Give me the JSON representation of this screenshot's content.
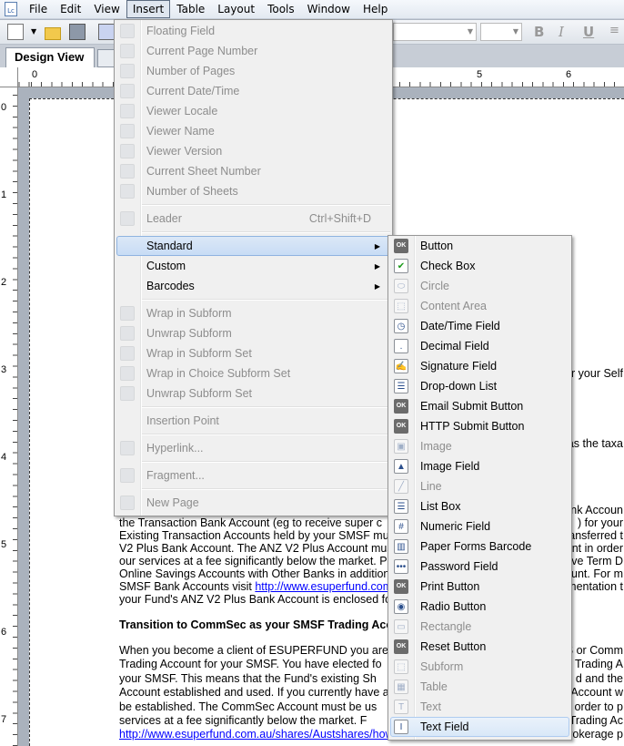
{
  "menubar": {
    "items": [
      "File",
      "Edit",
      "View",
      "Insert",
      "Table",
      "Layout",
      "Tools",
      "Window",
      "Help"
    ],
    "open": "Insert"
  },
  "tabs": {
    "design": "Design View"
  },
  "ruler": {
    "h": [
      "0",
      "5",
      "6"
    ],
    "v": [
      "0",
      "1",
      "2",
      "3",
      "4",
      "5",
      "6",
      "7"
    ]
  },
  "insert_menu": [
    {
      "label": "Floating Field",
      "icon": "floating-field-icon",
      "disabled": true
    },
    {
      "label": "Current Page Number",
      "icon": "page-number-icon",
      "disabled": true
    },
    {
      "label": "Number of Pages",
      "icon": "number-pages-icon",
      "disabled": true
    },
    {
      "label": "Current Date/Time",
      "icon": "date-time-icon",
      "disabled": true
    },
    {
      "label": "Viewer Locale",
      "icon": "viewer-locale-icon",
      "disabled": true
    },
    {
      "label": "Viewer Name",
      "icon": "viewer-name-icon",
      "disabled": true
    },
    {
      "label": "Viewer Version",
      "icon": "viewer-version-icon",
      "disabled": true
    },
    {
      "label": "Current Sheet Number",
      "icon": "sheet-number-icon",
      "disabled": true
    },
    {
      "label": "Number of Sheets",
      "icon": "number-sheets-icon",
      "disabled": true
    },
    {
      "sep": true
    },
    {
      "label": "Leader",
      "icon": "leader-icon",
      "disabled": true,
      "shortcut": "Ctrl+Shift+D"
    },
    {
      "sep": true
    },
    {
      "label": "Standard",
      "submenu": true,
      "highlighted": true
    },
    {
      "label": "Custom",
      "submenu": true
    },
    {
      "label": "Barcodes",
      "submenu": true
    },
    {
      "sep": true
    },
    {
      "label": "Wrap in Subform",
      "icon": "wrap-subform-icon",
      "disabled": true
    },
    {
      "label": "Unwrap Subform",
      "icon": "unwrap-subform-icon",
      "disabled": true
    },
    {
      "label": "Wrap in Subform Set",
      "icon": "wrap-subform-set-icon",
      "disabled": true
    },
    {
      "label": "Wrap in Choice Subform Set",
      "icon": "wrap-choice-subform-icon",
      "disabled": true
    },
    {
      "label": "Unwrap Subform Set",
      "icon": "unwrap-subform-set-icon",
      "disabled": true
    },
    {
      "sep": true
    },
    {
      "label": "Insertion Point",
      "disabled": true
    },
    {
      "sep": true
    },
    {
      "label": "Hyperlink...",
      "icon": "hyperlink-icon",
      "disabled": true
    },
    {
      "sep": true
    },
    {
      "label": "Fragment...",
      "icon": "fragment-icon",
      "disabled": true
    },
    {
      "sep": true
    },
    {
      "label": "New Page",
      "icon": "new-page-icon",
      "disabled": true
    }
  ],
  "standard_menu": [
    {
      "label": "Button",
      "icon": "ok-button-icon",
      "glyph": "OK"
    },
    {
      "label": "Check Box",
      "icon": "checkbox-icon",
      "glyph": "✔"
    },
    {
      "label": "Circle",
      "icon": "circle-icon",
      "glyph": "⬭",
      "disabled": true
    },
    {
      "label": "Content Area",
      "icon": "content-area-icon",
      "glyph": "⬚",
      "disabled": true
    },
    {
      "label": "Date/Time Field",
      "icon": "date-time-field-icon",
      "glyph": "◷"
    },
    {
      "label": "Decimal Field",
      "icon": "decimal-field-icon",
      "glyph": "."
    },
    {
      "label": "Signature Field",
      "icon": "signature-field-icon",
      "glyph": "✍"
    },
    {
      "label": "Drop-down List",
      "icon": "dropdown-list-icon",
      "glyph": "☰"
    },
    {
      "label": "Email Submit Button",
      "icon": "email-submit-icon",
      "glyph": "OK"
    },
    {
      "label": "HTTP Submit Button",
      "icon": "http-submit-icon",
      "glyph": "OK"
    },
    {
      "label": "Image",
      "icon": "image-icon",
      "glyph": "▣",
      "disabled": true
    },
    {
      "label": "Image Field",
      "icon": "image-field-icon",
      "glyph": "▲"
    },
    {
      "label": "Line",
      "icon": "line-icon",
      "glyph": "╱",
      "disabled": true
    },
    {
      "label": "List Box",
      "icon": "list-box-icon",
      "glyph": "☰"
    },
    {
      "label": "Numeric Field",
      "icon": "numeric-field-icon",
      "glyph": "#"
    },
    {
      "label": "Paper Forms Barcode",
      "icon": "barcode-icon",
      "glyph": "▥"
    },
    {
      "label": "Password Field",
      "icon": "password-field-icon",
      "glyph": "•••"
    },
    {
      "label": "Print Button",
      "icon": "print-button-icon",
      "glyph": "OK"
    },
    {
      "label": "Radio Button",
      "icon": "radio-button-icon",
      "glyph": "◉"
    },
    {
      "label": "Rectangle",
      "icon": "rectangle-icon",
      "glyph": "▭",
      "disabled": true
    },
    {
      "label": "Reset Button",
      "icon": "reset-button-icon",
      "glyph": "OK"
    },
    {
      "label": "Subform",
      "icon": "subform-icon",
      "glyph": "⬚",
      "disabled": true
    },
    {
      "label": "Table",
      "icon": "table-icon",
      "glyph": "▦",
      "disabled": true
    },
    {
      "label": "Text",
      "icon": "text-icon",
      "glyph": "T",
      "disabled": true
    },
    {
      "label": "Text Field",
      "icon": "text-field-icon",
      "glyph": "I",
      "highlighted": true
    }
  ],
  "doc": {
    "right_only": [
      "r your Self",
      "as the taxa",
      "ank Accoun"
    ],
    "lines": [
      {
        "l": "the Transaction Bank Account (eg to receive super c",
        "r": ")  for your"
      },
      {
        "l": "Existing Transaction Accounts held by your SMSF mus",
        "r": "ransferred t"
      },
      {
        "l": "V2 Plus Bank Account. The ANZ V2 Plus Account mus",
        "r": "unt in order"
      },
      {
        "l": "our services at a fee significantly below the market.   Pl",
        "r": "ave Term D"
      },
      {
        "l": "Online Savings Accounts with Other Banks in addition",
        "r": "ount. For m"
      },
      {
        "l": "SMSF Bank Accounts visit ",
        "link": "http://www.esuperfund.com",
        "r": "mentation t"
      },
      {
        "l": "your Fund's ANZ V2 Plus Bank Account is enclosed for",
        "r": ""
      }
    ],
    "heading": "Transition to CommSec as your SMSF Trading Acc",
    "lines2": [
      {
        "l": "When you become a client of ESUPERFUND you are",
        "r": "S or Comm"
      },
      {
        "l": "Trading Account for your SMSF.  You have elected fo",
        "r": "e Trading A"
      },
      {
        "l": "your SMSF. This means that the Fund's existing Sh",
        "r": "d and the"
      },
      {
        "l": "Account established and used.  If you currently have a",
        "r": "c Account w"
      },
      {
        "l": "be established.   The CommSec Account must be us",
        "r": "n order to p"
      },
      {
        "l": "services at a fee significantly below the market.  F",
        "r": "Trading Ac"
      },
      {
        "link": "http://www.esuperfund.com.au/shares/Austshares/howi",
        "r": "rokerage p"
      }
    ]
  }
}
